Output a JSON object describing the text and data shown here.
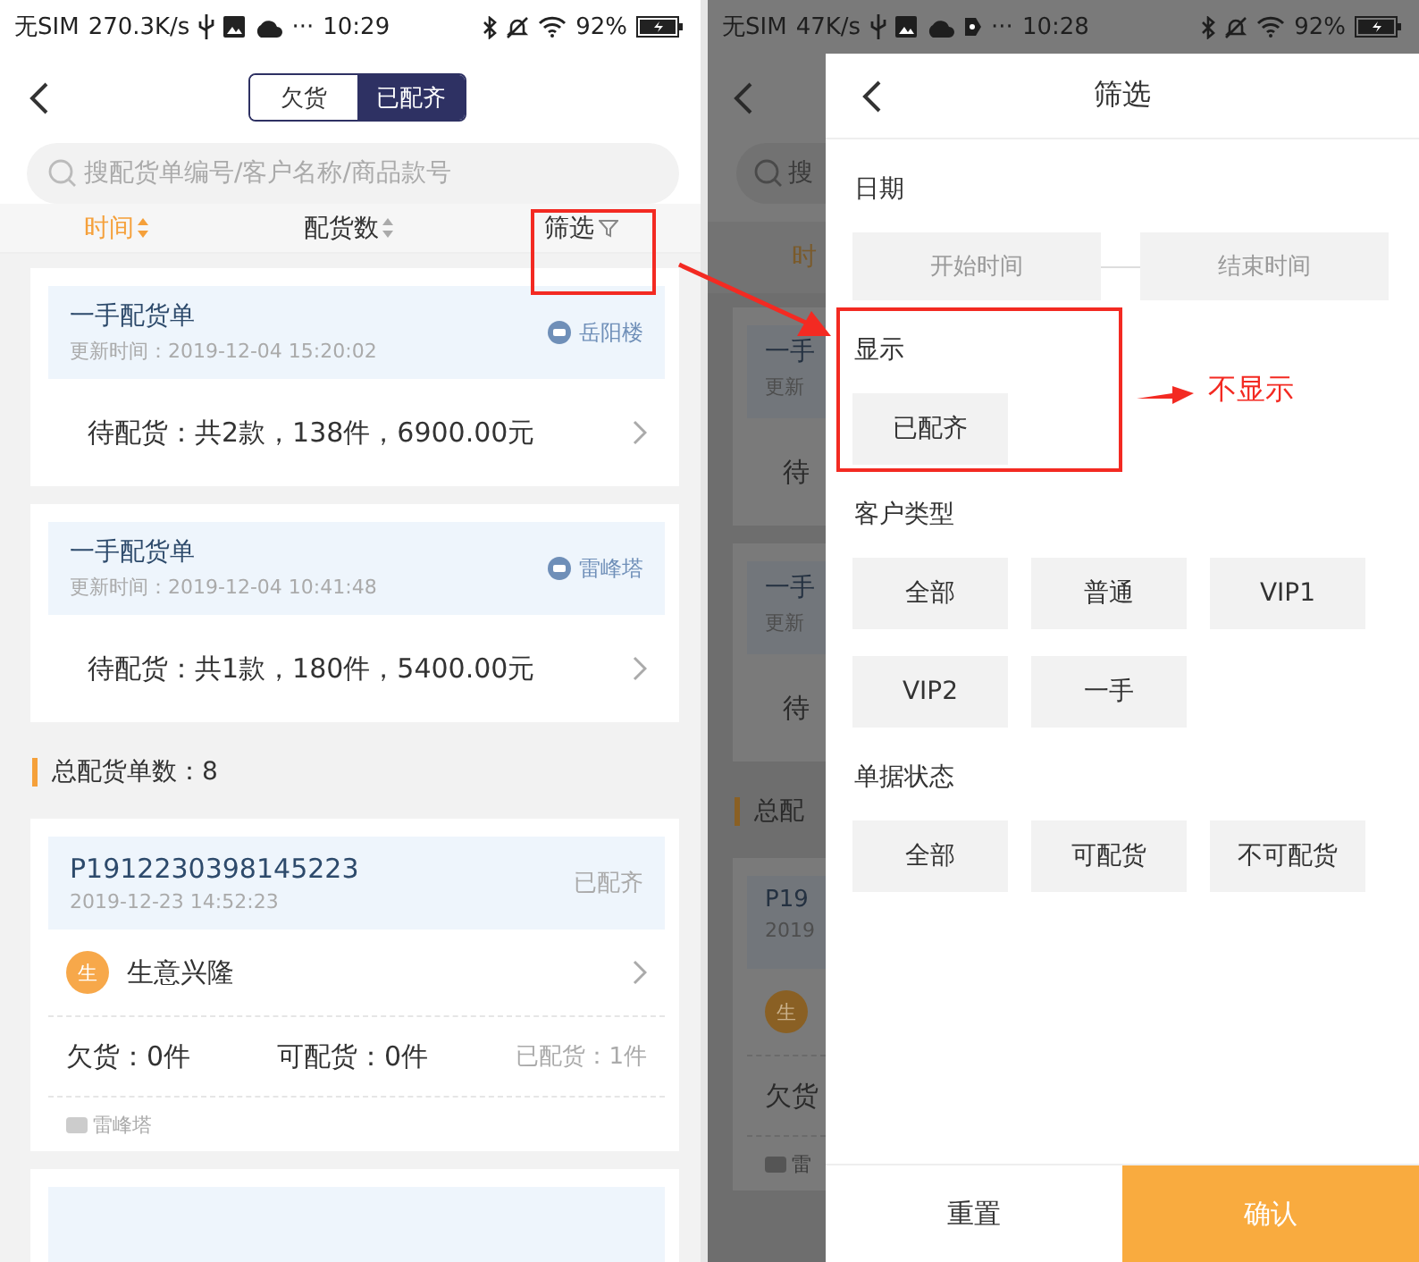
{
  "left_screen": {
    "status_bar": {
      "carrier": "无SIM",
      "speed": "270.3K/s",
      "more": "···",
      "time": "10:29",
      "battery": "92%"
    },
    "tabs": [
      {
        "label": "欠货",
        "selected": false
      },
      {
        "label": "已配齐",
        "selected": true
      }
    ],
    "search": {
      "placeholder": "搜配货单编号/客户名称/商品款号"
    },
    "sort_bar": [
      {
        "label": "时间",
        "kind": "sort",
        "selected": true
      },
      {
        "label": "配货数",
        "kind": "sort",
        "selected": false
      },
      {
        "label": "筛选",
        "kind": "filter",
        "selected": false
      }
    ],
    "pending_cards": [
      {
        "title": "一手配货单",
        "updated": "更新时间：2019-12-04 15:20:02",
        "store": "岳阳楼",
        "summary": "待配货：共2款，138件，6900.00元"
      },
      {
        "title": "一手配货单",
        "updated": "更新时间：2019-12-04 10:41:48",
        "store": "雷峰塔",
        "summary": "待配货：共1款，180件，5400.00元"
      }
    ],
    "total": "总配货单数：8",
    "orders": [
      {
        "id": "P1912230398145223",
        "time": "2019-12-23 14:52:23",
        "status": "已配齐",
        "avatar": "生",
        "customer": "生意兴隆",
        "shortage": "欠货：0件",
        "available": "可配货：0件",
        "allocated": "已配货：1件",
        "store": "雷峰塔"
      }
    ]
  },
  "right_screen": {
    "status_bar": {
      "carrier": "无SIM",
      "speed": "47K/s",
      "more": "···",
      "time": "10:28",
      "battery": "92%"
    },
    "background": {
      "search": "搜",
      "sort": "时",
      "cards": [
        {
          "title": "一手",
          "updated": "更新",
          "summary": "待"
        },
        {
          "title": "一手",
          "updated": "更新",
          "summary": "待"
        }
      ],
      "total": "总配",
      "order": {
        "id": "P19",
        "time": "2019",
        "avatar": "生",
        "shortage": "欠货",
        "store": "雷"
      }
    },
    "filter_panel": {
      "title": "筛选",
      "sections": [
        {
          "title": "日期",
          "kind": "range",
          "fields": [
            {
              "placeholder": "开始时间"
            },
            {
              "placeholder": "结束时间"
            }
          ]
        },
        {
          "title": "显示",
          "kind": "options",
          "options": [
            {
              "label": "已配齐",
              "selected": false
            }
          ]
        },
        {
          "title": "客户类型",
          "kind": "options",
          "options": [
            {
              "label": "全部",
              "selected": false
            },
            {
              "label": "普通",
              "selected": false
            },
            {
              "label": "VIP1",
              "selected": false
            },
            {
              "label": "VIP2",
              "selected": false
            },
            {
              "label": "一手",
              "selected": false
            }
          ]
        },
        {
          "title": "单据状态",
          "kind": "options",
          "options": [
            {
              "label": "全部",
              "selected": false
            },
            {
              "label": "可配货",
              "selected": false
            },
            {
              "label": "不可配货",
              "selected": false
            }
          ]
        }
      ],
      "buttons": [
        {
          "label": "重置",
          "kind": "secondary"
        },
        {
          "label": "确认",
          "kind": "primary"
        }
      ]
    }
  },
  "annotation": {
    "note": "不显示"
  }
}
